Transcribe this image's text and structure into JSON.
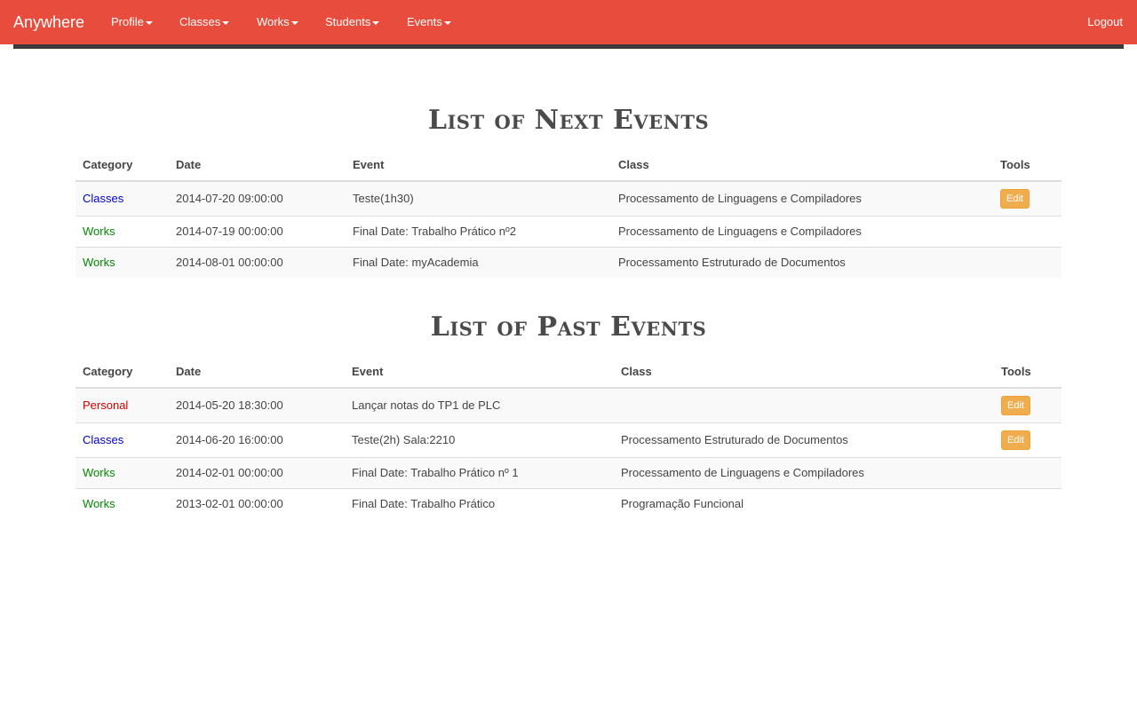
{
  "navbar": {
    "brand": "Anywhere",
    "menu": [
      {
        "label": "Profile"
      },
      {
        "label": "Classes"
      },
      {
        "label": "Works"
      },
      {
        "label": "Students"
      },
      {
        "label": "Events"
      }
    ],
    "logout": "Logout"
  },
  "next_events": {
    "title": "List of Next Events",
    "headers": {
      "category": "Category",
      "date": "Date",
      "event": "Event",
      "class": "Class",
      "tools": "Tools"
    },
    "rows": [
      {
        "category": "Classes",
        "category_color": "#0000cc",
        "date": "2014-07-20 09:00:00",
        "event": "Teste(1h30)",
        "class": "Processamento de Linguagens e Compiladores",
        "tool": "Edit"
      },
      {
        "category": "Works",
        "category_color": "#008800",
        "date": "2014-07-19 00:00:00",
        "event": "Final Date: Trabalho Prático nº2",
        "class": "Processamento de Linguagens e Compiladores",
        "tool": ""
      },
      {
        "category": "Works",
        "category_color": "#008800",
        "date": "2014-08-01 00:00:00",
        "event": "Final Date: myAcademia",
        "class": "Processamento Estruturado de Documentos",
        "tool": ""
      }
    ]
  },
  "past_events": {
    "title": "List of Past Events",
    "headers": {
      "category": "Category",
      "date": "Date",
      "event": "Event",
      "class": "Class",
      "tools": "Tools"
    },
    "rows": [
      {
        "category": "Personal",
        "category_color": "#cc0000",
        "date": "2014-05-20 18:30:00",
        "event": "Lançar notas do TP1 de PLC",
        "class": "",
        "tool": "Edit"
      },
      {
        "category": "Classes",
        "category_color": "#0000cc",
        "date": "2014-06-20 16:00:00",
        "event": "Teste(2h) Sala:2210",
        "class": "Processamento Estruturado de Documentos",
        "tool": "Edit"
      },
      {
        "category": "Works",
        "category_color": "#008800",
        "date": "2014-02-01 00:00:00",
        "event": "Final Date: Trabalho Prático nº 1",
        "class": "Processamento de Linguagens e Compiladores",
        "tool": ""
      },
      {
        "category": "Works",
        "category_color": "#008800",
        "date": "2013-02-01 00:00:00",
        "event": "Final Date: Trabalho Prático",
        "class": "Programação Funcional",
        "tool": ""
      }
    ]
  },
  "colors": {
    "navbar": "#e74c3c",
    "edit_button": "#f0ad4e"
  }
}
